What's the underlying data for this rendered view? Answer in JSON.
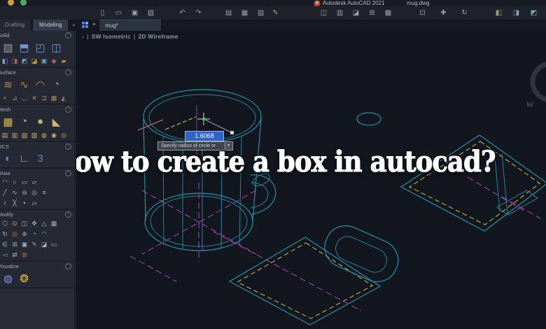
{
  "window": {
    "app_title": "Autodesk AutoCAD 2021",
    "doc_title": "mug.dwg"
  },
  "toolbar": {
    "groups": [
      {
        "icons": [
          {
            "name": "new-file-icon",
            "glyph": "▯"
          },
          {
            "name": "open-file-icon",
            "glyph": "▭"
          },
          {
            "name": "save-icon",
            "glyph": "▣"
          },
          {
            "name": "save-as-icon",
            "glyph": "▨"
          }
        ]
      },
      {
        "icons": [
          {
            "name": "undo-icon",
            "glyph": "↶"
          },
          {
            "name": "redo-icon",
            "glyph": "↷"
          }
        ]
      },
      {
        "icons": [
          {
            "name": "print-icon",
            "glyph": "▤"
          },
          {
            "name": "batch-plot-icon",
            "glyph": "▦"
          },
          {
            "name": "plot-preview-icon",
            "glyph": "▧"
          }
        ]
      },
      {
        "icons": [
          {
            "name": "edit-icon",
            "glyph": "✎",
            "color": "#b3a169"
          }
        ]
      },
      {
        "icons": [
          {
            "name": "copy-icon",
            "glyph": "◫"
          },
          {
            "name": "paste-icon",
            "glyph": "▥"
          },
          {
            "name": "match-properties-icon",
            "glyph": "◪"
          },
          {
            "name": "block-icon",
            "glyph": "⊞"
          },
          {
            "name": "measure-icon",
            "glyph": "▩"
          }
        ]
      },
      {
        "icons": [
          {
            "name": "zoom-window-icon",
            "glyph": "⊡"
          },
          {
            "name": "pan-icon",
            "glyph": "✚"
          },
          {
            "name": "orbit-icon",
            "glyph": "↻"
          }
        ]
      },
      {
        "icons": [
          {
            "name": "layer-icon",
            "glyph": "◧",
            "color": "#9aa86f"
          },
          {
            "name": "properties-icon",
            "glyph": "◨",
            "color": "#8aa0b8"
          },
          {
            "name": "render-icon",
            "glyph": "◩",
            "color": "#7fae8a"
          },
          {
            "name": "share-icon",
            "glyph": "⊚",
            "color": "#8aa0b8"
          }
        ]
      }
    ]
  },
  "tabs": {
    "palette_tabs": [
      {
        "label": "Drafting"
      },
      {
        "label": "Modeling"
      }
    ],
    "collapse_glyph": "«",
    "new_tab_glyph": "+",
    "file_tab": "mug*"
  },
  "viewport": {
    "collapse": "-",
    "view": "SW Isometric",
    "visual_style": "2D Wireframe"
  },
  "palette": {
    "sections": [
      {
        "label": "Solid",
        "rows": [
          {
            "size": "lg",
            "icons": [
              {
                "name": "box-icon",
                "glyph": "▧",
                "color": "#969da5"
              },
              {
                "name": "extrude-icon",
                "glyph": "⬒",
                "color": "#6d96cc"
              },
              {
                "name": "polysolid-icon",
                "glyph": "◰",
                "color": "#6d96cc"
              },
              {
                "name": "presspull-icon",
                "glyph": "◫",
                "color": "#6d96cc"
              }
            ]
          },
          {
            "size": "sm",
            "icons": [
              {
                "name": "union-icon",
                "glyph": "◧",
                "color": "#7d9cc4"
              },
              {
                "name": "subtract-icon",
                "glyph": "◨",
                "color": "#b06060"
              },
              {
                "name": "intersect-icon",
                "glyph": "◩",
                "color": "#7d9cc4"
              },
              {
                "name": "slice-icon",
                "glyph": "◪",
                "color": "#c9a23c"
              },
              {
                "name": "shell-icon",
                "glyph": "▣",
                "color": "#7d9cc4"
              },
              {
                "name": "fillet-edge-icon",
                "glyph": "◆",
                "color": "#b06060"
              },
              {
                "name": "taper-face-icon",
                "glyph": "▰",
                "color": "#c9853c"
              }
            ]
          }
        ]
      },
      {
        "label": "Surface",
        "rows": [
          {
            "size": "lg",
            "icons": [
              {
                "name": "surface-network-icon",
                "glyph": "≋",
                "color": "#c08552"
              },
              {
                "name": "surface-loft-icon",
                "glyph": "∿",
                "color": "#c08552"
              },
              {
                "name": "surface-sweep-icon",
                "glyph": "◠",
                "color": "#c08552"
              },
              {
                "name": "surface-patch-icon",
                "glyph": "◔",
                "color": "#c08552"
              }
            ]
          },
          {
            "size": "sm",
            "icons": [
              {
                "name": "surface-blend-icon",
                "glyph": "≈",
                "color": "#c08552"
              },
              {
                "name": "surface-offset-icon",
                "glyph": "⊿",
                "color": "#c08552"
              },
              {
                "name": "surface-fillet-icon",
                "glyph": "◡",
                "color": "#c08552"
              },
              {
                "name": "surface-trim-icon",
                "glyph": "✕",
                "color": "#c08552"
              },
              {
                "name": "surface-extend-icon",
                "glyph": "⊐",
                "color": "#c08552"
              },
              {
                "name": "surface-sculpt-icon",
                "glyph": "▦",
                "color": "#c08552"
              },
              {
                "name": "surface-convert-icon",
                "glyph": "◭",
                "color": "#c08552"
              }
            ]
          }
        ]
      },
      {
        "label": "Mesh",
        "rows": [
          {
            "size": "lg",
            "icons": [
              {
                "name": "mesh-box-icon",
                "glyph": "▦",
                "color": "#cdb36b"
              },
              {
                "name": "mesh-smooth-icon",
                "glyph": "◔",
                "color": "#cdb36b"
              },
              {
                "name": "mesh-sphere-icon",
                "glyph": "●",
                "color": "#cdb36b"
              },
              {
                "name": "mesh-wedge-icon",
                "glyph": "◣",
                "color": "#cdb36b"
              }
            ]
          },
          {
            "size": "sm",
            "icons": [
              {
                "name": "mesh-refine-icon",
                "glyph": "▤",
                "color": "#cdb36b"
              },
              {
                "name": "mesh-crease-icon",
                "glyph": "▥",
                "color": "#cdb36b"
              },
              {
                "name": "mesh-split-icon",
                "glyph": "▧",
                "color": "#cdb36b"
              },
              {
                "name": "mesh-extrude-icon",
                "glyph": "▨",
                "color": "#cdb36b"
              },
              {
                "name": "mesh-merge-icon",
                "glyph": "◍",
                "color": "#cdb36b"
              },
              {
                "name": "mesh-close-icon",
                "glyph": "◉",
                "color": "#cdb36b"
              },
              {
                "name": "mesh-spin-icon",
                "glyph": "◎",
                "color": "#cdb36b"
              }
            ]
          }
        ]
      },
      {
        "label": "UCS",
        "rows": [
          {
            "size": "lg",
            "icons": [
              {
                "name": "world-ucs-icon",
                "glyph": "◐",
                "color": "#5b87c5"
              },
              {
                "name": "ucs-icon",
                "glyph": "∟",
                "color": "#9fb0bd"
              },
              {
                "name": "named-ucs-icon",
                "glyph": "3",
                "color": "#5b87c5"
              }
            ]
          }
        ]
      },
      {
        "label": "Draw",
        "rows": [
          {
            "size": "sm",
            "icons": [
              {
                "name": "arc-icon",
                "glyph": "◠",
                "color": "#aeb6c2"
              },
              {
                "name": "circle-icon",
                "glyph": "○",
                "color": "#aeb6c2"
              },
              {
                "name": "rectangle-icon",
                "glyph": "▭",
                "color": "#aeb6c2"
              },
              {
                "name": "planar-surface-icon",
                "glyph": "▱",
                "color": "#aeb6c2"
              }
            ]
          },
          {
            "size": "sm",
            "icons": [
              {
                "name": "line-icon",
                "glyph": "╱",
                "color": "#aeb6c2"
              },
              {
                "name": "polyline-icon",
                "glyph": "∿",
                "color": "#aeb6c2"
              },
              {
                "name": "ellipse-icon",
                "glyph": "⊖",
                "color": "#aeb6c2"
              },
              {
                "name": "donut-icon",
                "glyph": "◎",
                "color": "#aeb6c2"
              },
              {
                "name": "hatch-icon",
                "glyph": "≡",
                "color": "#aeb6c2"
              }
            ]
          },
          {
            "size": "sm",
            "icons": [
              {
                "name": "spline-icon",
                "glyph": "≀",
                "color": "#aeb6c2"
              },
              {
                "name": "xline-icon",
                "glyph": "╳",
                "color": "#aeb6c2"
              },
              {
                "name": "point-icon",
                "glyph": "•",
                "color": "#aeb6c2"
              },
              {
                "name": "region-icon",
                "glyph": "▱",
                "color": "#aeb6c2"
              }
            ]
          }
        ]
      },
      {
        "label": "Modify",
        "rows": [
          {
            "size": "sm",
            "icons": [
              {
                "name": "3d-move-icon",
                "glyph": "⬡",
                "color": "#9fb0bd"
              },
              {
                "name": "3d-rotate-icon",
                "glyph": "⊙",
                "color": "#9fb0bd"
              },
              {
                "name": "3d-scale-icon",
                "glyph": "◫",
                "color": "#9fb0bd"
              },
              {
                "name": "move-icon",
                "glyph": "✥",
                "color": "#9fb0bd"
              },
              {
                "name": "mirror-icon",
                "glyph": "△",
                "color": "#9fb0bd"
              },
              {
                "name": "array-icon",
                "glyph": "▦",
                "color": "#9fb0bd"
              }
            ]
          },
          {
            "size": "sm",
            "icons": [
              {
                "name": "rotate-icon",
                "glyph": "↻",
                "color": "#9fb0bd"
              },
              {
                "name": "offset-icon",
                "glyph": "◎",
                "color": "#c9853c"
              },
              {
                "name": "trim-icon",
                "glyph": "⊕",
                "color": "#9fb0bd"
              },
              {
                "name": "extend-icon",
                "glyph": "◔",
                "color": "#9fb0bd"
              },
              {
                "name": "fillet-icon",
                "glyph": "◠",
                "color": "#9fb0bd"
              }
            ]
          },
          {
            "size": "sm",
            "icons": [
              {
                "name": "stretch-icon",
                "glyph": "∈",
                "color": "#9fb0bd"
              },
              {
                "name": "scale-icon",
                "glyph": "⊞",
                "color": "#9fb0bd"
              },
              {
                "name": "chamfer-icon",
                "glyph": "▣",
                "color": "#9fb0bd"
              },
              {
                "name": "edit-polyline-icon",
                "glyph": "✎",
                "color": "#b3a169"
              },
              {
                "name": "explode-icon",
                "glyph": "◪",
                "color": "#9fb0bd"
              },
              {
                "name": "break-icon",
                "glyph": "▭",
                "color": "#9fb0bd"
              }
            ]
          },
          {
            "size": "sm",
            "icons": [
              {
                "name": "join-icon",
                "glyph": "◅",
                "color": "#c9853c"
              },
              {
                "name": "align-icon",
                "glyph": "⇄",
                "color": "#9fb0bd"
              },
              {
                "name": "erase-icon",
                "glyph": "⊠",
                "color": "#b06060"
              }
            ]
          }
        ]
      },
      {
        "label": "Visualize",
        "rows": [
          {
            "size": "lg",
            "icons": [
              {
                "name": "materials-icon",
                "glyph": "◍",
                "color": "#8b93c9"
              },
              {
                "name": "light-bulb-icon",
                "glyph": "❂",
                "color": "#e0be3e"
              }
            ]
          }
        ]
      }
    ]
  },
  "drawing": {
    "tooltip_value": "1.6068",
    "tooltip_prompt": "Specify radius of circle or",
    "tooltip_drop_glyph": "▾",
    "watermark_letter": "w",
    "colors": {
      "teal": "#2591a4",
      "magenta": "#a43fae",
      "yellow": "#b5a53e",
      "red": "#c65f5f",
      "green": "#5abf5e",
      "selection_blue": "#2e63c7"
    }
  },
  "headline": {
    "text": "How to create a box in autocad?"
  }
}
